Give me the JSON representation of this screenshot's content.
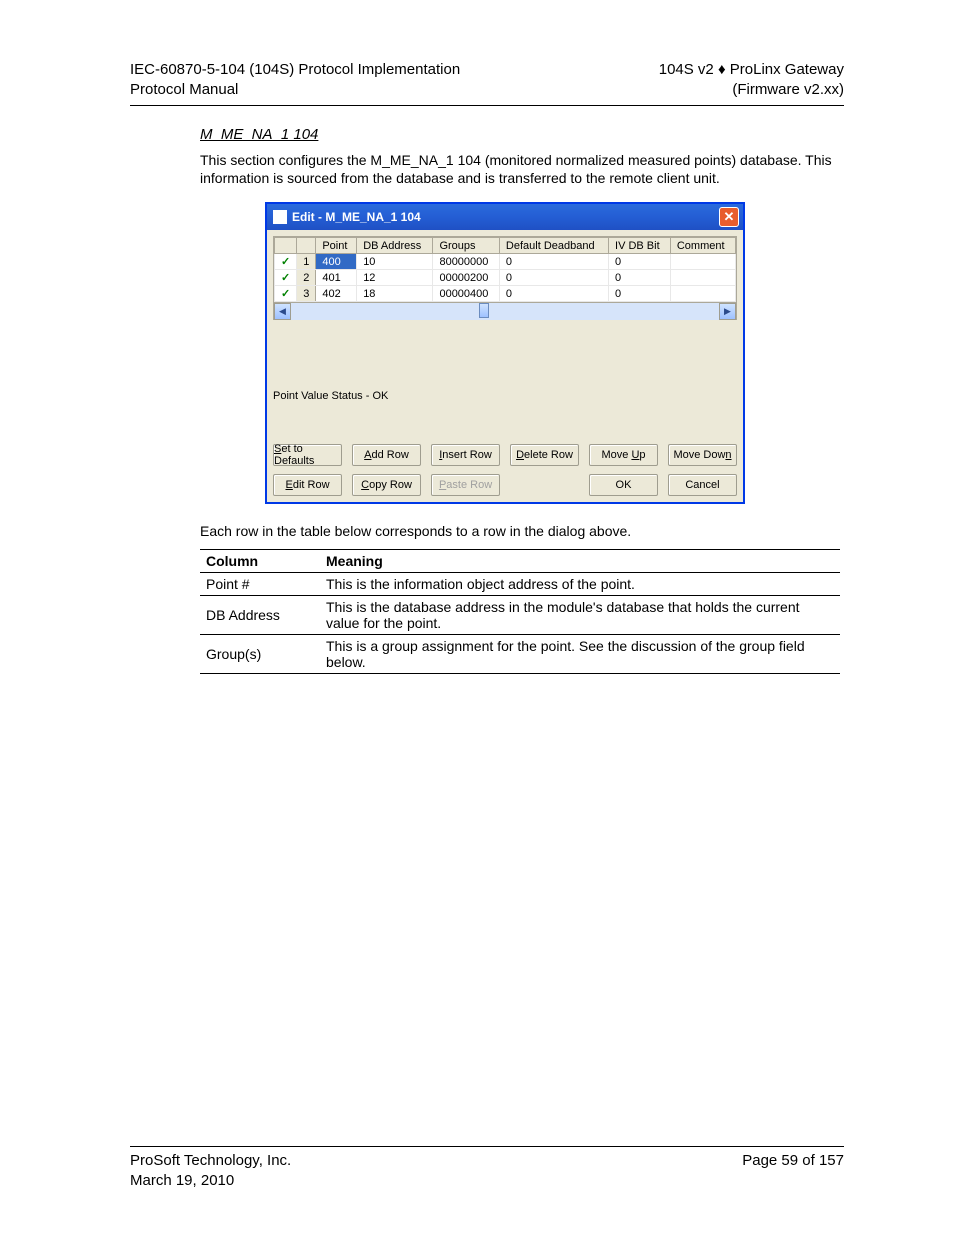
{
  "header": {
    "left_line1": "IEC-60870-5-104 (104S) Protocol Implementation",
    "left_line2": "Protocol Manual",
    "right_line1": "104S v2 ♦ ProLinx Gateway",
    "right_line2": "(Firmware v2.xx)"
  },
  "section": {
    "title": "M_ME_NA_1 104",
    "intro": "This section configures the M_ME_NA_1 104 (monitored normalized measured points) database. This information is sourced from the database and is transferred to the remote client unit."
  },
  "dialog": {
    "title": "Edit - M_ME_NA_1 104",
    "columns": [
      "",
      "Point",
      "DB Address",
      "Groups",
      "Default Deadband",
      "IV DB Bit",
      "Comment"
    ],
    "rows": [
      {
        "n": "1",
        "point": "400",
        "db": "10",
        "groups": "80000000",
        "dd": "0",
        "iv": "0",
        "comment": ""
      },
      {
        "n": "2",
        "point": "401",
        "db": "12",
        "groups": "00000200",
        "dd": "0",
        "iv": "0",
        "comment": ""
      },
      {
        "n": "3",
        "point": "402",
        "db": "18",
        "groups": "00000400",
        "dd": "0",
        "iv": "0",
        "comment": ""
      }
    ],
    "status_line": "Point Value Status - OK",
    "buttons": {
      "set_defaults": "Set to Defaults",
      "add_row": "Add Row",
      "insert_row": "Insert Row",
      "delete_row": "Delete Row",
      "move_up": "Move Up",
      "move_down": "Move Down",
      "edit_row": "Edit Row",
      "copy_row": "Copy Row",
      "paste_row": "Paste Row",
      "ok": "OK",
      "cancel": "Cancel"
    }
  },
  "after_dialog": "Each row in the table below corresponds to a row in the dialog above.",
  "data_table": {
    "hdr_col": "Column",
    "hdr_meaning": "Meaning",
    "rows": [
      {
        "c": "Point #",
        "m": "This is the information object address of the point."
      },
      {
        "c": "DB Address",
        "m": "This is the database address in the module's database that holds the current value for the point."
      },
      {
        "c": "Group(s)",
        "m": "This is a group assignment for the point. See the discussion of the group field below."
      }
    ]
  },
  "footer": {
    "left_line1": "ProSoft Technology, Inc.",
    "left_line2": "March 19, 2010",
    "right_line1": "Page 59 of 157"
  }
}
